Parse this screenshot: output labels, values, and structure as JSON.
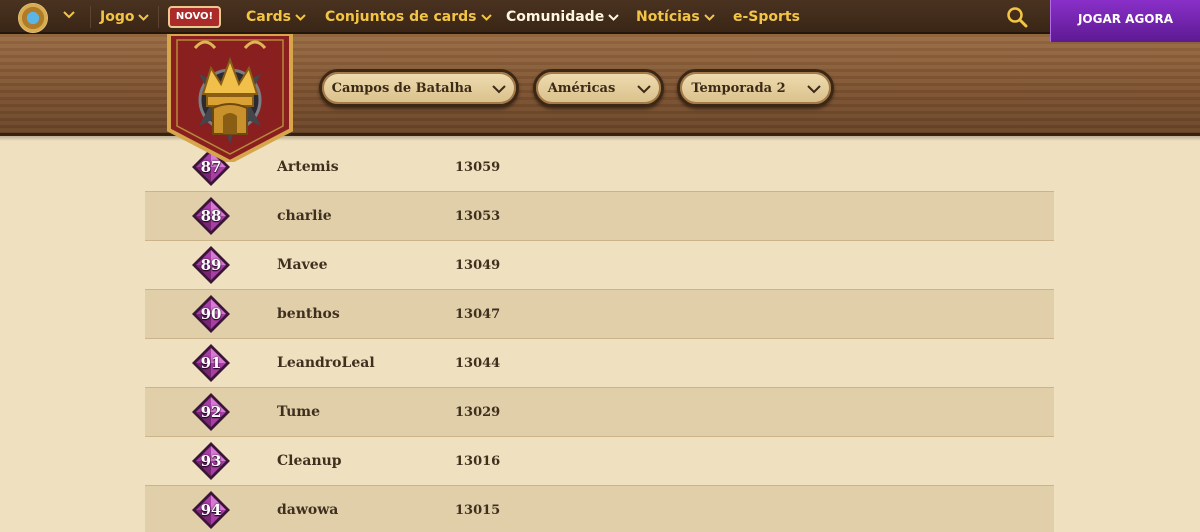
{
  "nav": {
    "items": [
      {
        "label": "Jogo",
        "has_menu": true
      },
      {
        "label": "Cards",
        "has_menu": true
      },
      {
        "label": "Conjuntos de cards",
        "has_menu": true
      },
      {
        "label": "Comunidade",
        "has_menu": true,
        "active": true
      },
      {
        "label": "Notícias",
        "has_menu": true
      },
      {
        "label": "e-Sports",
        "has_menu": false
      }
    ],
    "novo_badge": "NOVO!",
    "play_button": "JOGAR AGORA",
    "search_icon": "search-icon",
    "colors": {
      "nav_text": "#f3c545",
      "active_text": "#fff6e0",
      "play": "#7a28b8",
      "badge": "#ab2a2a"
    }
  },
  "filters": [
    {
      "label": "Campos de Batalha"
    },
    {
      "label": "Américas"
    },
    {
      "label": "Temporada 2"
    }
  ],
  "leaderboard": {
    "rows": [
      {
        "rank": "87",
        "player": "Artemis",
        "rating": "13059"
      },
      {
        "rank": "88",
        "player": "charlie",
        "rating": "13053"
      },
      {
        "rank": "89",
        "player": "Mavee",
        "rating": "13049"
      },
      {
        "rank": "90",
        "player": "benthos",
        "rating": "13047"
      },
      {
        "rank": "91",
        "player": "LeandroLeal",
        "rating": "13044"
      },
      {
        "rank": "92",
        "player": "Tume",
        "rating": "13029"
      },
      {
        "rank": "93",
        "player": "Cleanup",
        "rating": "13016"
      },
      {
        "rank": "94",
        "player": "dawowa",
        "rating": "13015"
      }
    ]
  }
}
